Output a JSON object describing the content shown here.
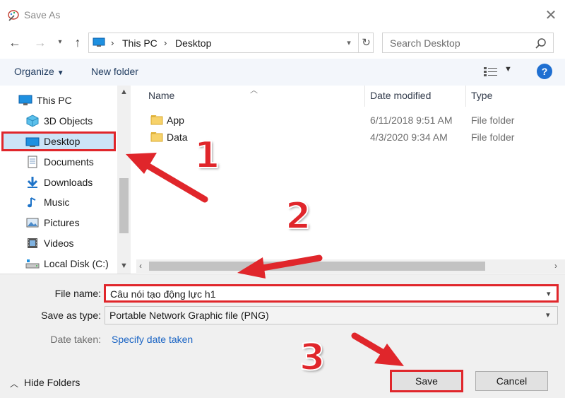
{
  "window": {
    "title": "Save As"
  },
  "address": {
    "crumbs": [
      "This PC",
      "Desktop"
    ]
  },
  "search": {
    "placeholder": "Search Desktop"
  },
  "toolbar": {
    "organize": "Organize",
    "new_folder": "New folder"
  },
  "nav": {
    "items": [
      {
        "label": "This PC",
        "icon": "computer-icon"
      },
      {
        "label": "3D Objects",
        "icon": "cube-icon"
      },
      {
        "label": "Desktop",
        "icon": "desktop-icon",
        "selected": true
      },
      {
        "label": "Documents",
        "icon": "document-icon"
      },
      {
        "label": "Downloads",
        "icon": "download-icon"
      },
      {
        "label": "Music",
        "icon": "music-icon"
      },
      {
        "label": "Pictures",
        "icon": "pictures-icon"
      },
      {
        "label": "Videos",
        "icon": "videos-icon"
      },
      {
        "label": "Local Disk (C:)",
        "icon": "drive-icon"
      }
    ]
  },
  "files": {
    "columns": {
      "name": "Name",
      "date": "Date modified",
      "type": "Type"
    },
    "rows": [
      {
        "name": "App",
        "date": "6/11/2018 9:51 AM",
        "type": "File folder"
      },
      {
        "name": "Data",
        "date": "4/3/2020 9:34 AM",
        "type": "File folder"
      }
    ]
  },
  "form": {
    "file_name_label": "File name:",
    "file_name_value": "Câu nói tạo động lực h1",
    "save_type_label": "Save as type:",
    "save_type_value": "Portable Network Graphic file (PNG)",
    "date_taken_label": "Date taken:",
    "date_taken_link": "Specify date taken"
  },
  "footer": {
    "hide_folders": "Hide Folders",
    "save": "Save",
    "cancel": "Cancel"
  },
  "annotations": [
    "1",
    "2",
    "3"
  ],
  "colors": {
    "highlight": "#e0262b",
    "link": "#1a64c4",
    "selection": "#cce4f7",
    "accent": "#1f6fd1"
  }
}
